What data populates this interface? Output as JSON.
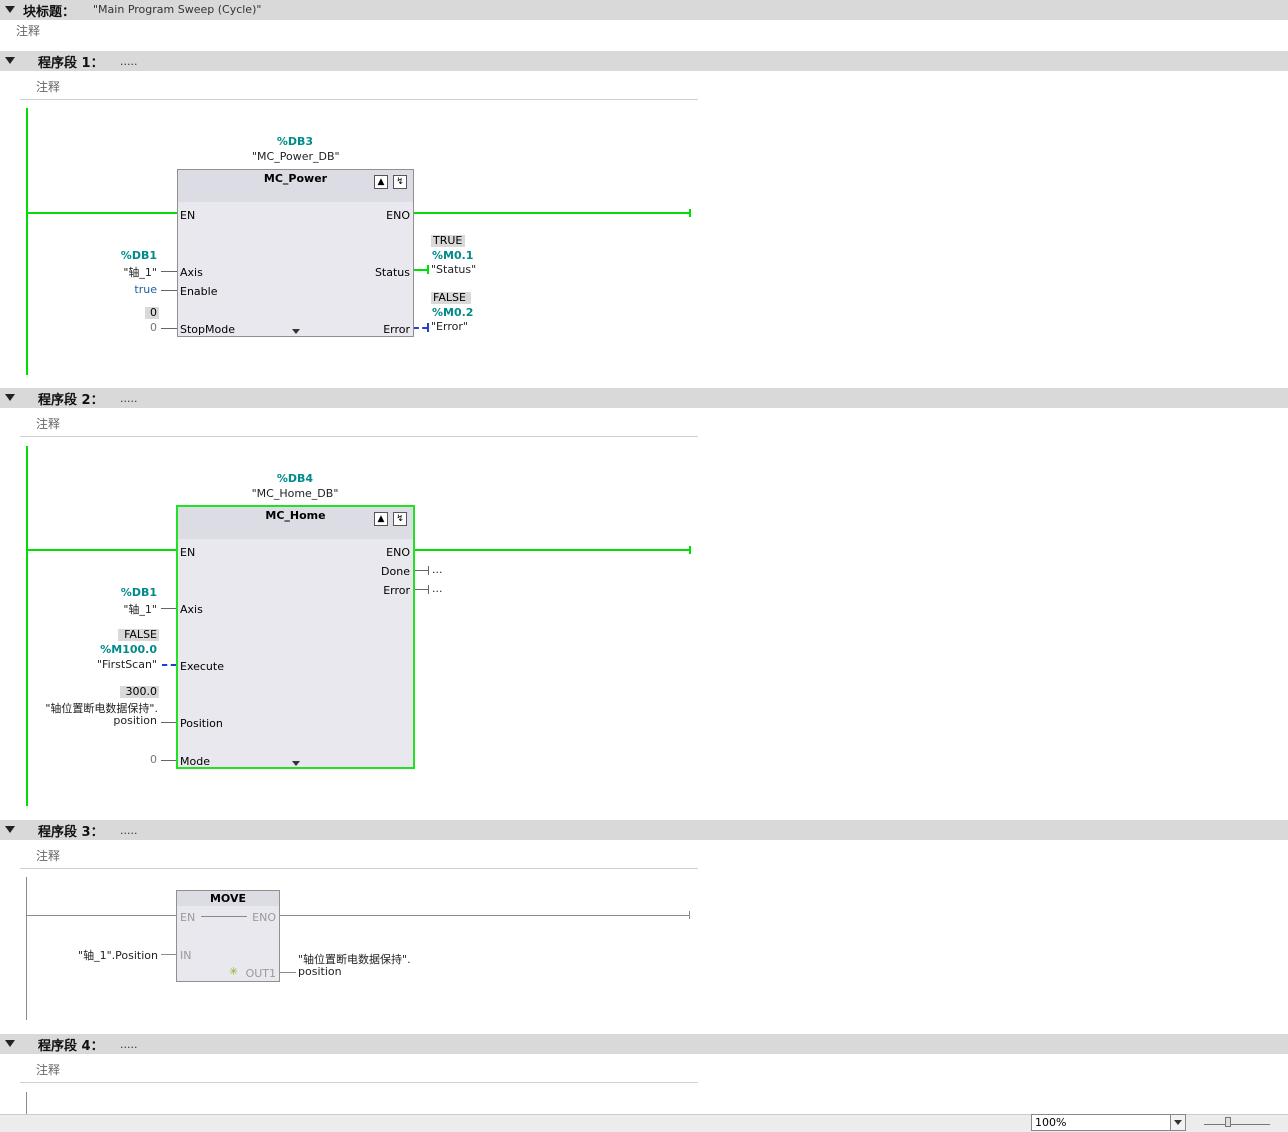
{
  "block": {
    "title_label": "块标题：",
    "title_value": "\"Main Program Sweep (Cycle)\"",
    "comment": "注释"
  },
  "networks": [
    {
      "label": "程序段 1：",
      "value": ".....",
      "comment": "注释"
    },
    {
      "label": "程序段 2：",
      "value": ".....",
      "comment": "注释"
    },
    {
      "label": "程序段 3：",
      "value": ".....",
      "comment": "注释"
    },
    {
      "label": "程序段 4：",
      "value": ".....",
      "comment": "注释"
    }
  ],
  "n1": {
    "db_addr": "%DB3",
    "db_name": "\"MC_Power_DB\"",
    "fb_name": "MC_Power",
    "pins_in": {
      "en": "EN",
      "axis": "Axis",
      "enable": "Enable",
      "stopmode": "StopMode"
    },
    "pins_out": {
      "eno": "ENO",
      "status": "Status",
      "error": "Error"
    },
    "axis_addr": "%DB1",
    "axis_name": "\"轴_1\"",
    "enable_val": "true",
    "stopmode_box": "0",
    "stopmode_val": "0",
    "status_box": "TRUE",
    "status_addr": "%M0.1",
    "status_name": "\"Status\"",
    "error_box": "FALSE",
    "error_addr": "%M0.2",
    "error_name": "\"Error\""
  },
  "n2": {
    "db_addr": "%DB4",
    "db_name": "\"MC_Home_DB\"",
    "fb_name": "MC_Home",
    "pins_in": {
      "en": "EN",
      "axis": "Axis",
      "execute": "Execute",
      "position": "Position",
      "mode": "Mode"
    },
    "pins_out": {
      "eno": "ENO",
      "done": "Done",
      "error": "Error"
    },
    "done_val": "...",
    "error_val": "...",
    "axis_addr": "%DB1",
    "axis_name": "\"轴_1\"",
    "execute_box": "FALSE",
    "execute_addr": "%M100.0",
    "execute_name": "\"FirstScan\"",
    "position_box": "300.0",
    "position_name1": "\"轴位置断电数据保持\".",
    "position_name2": "position",
    "mode_val": "0"
  },
  "n3": {
    "fb_name": "MOVE",
    "pin_en": "EN",
    "pin_eno": "ENO",
    "pin_in": "IN",
    "pin_out": "OUT1",
    "in_val": "\"轴_1\".Position",
    "out_val1": "\"轴位置断电数据保持\".",
    "out_val2": "position"
  },
  "statusbar": {
    "zoom": "100%"
  },
  "colors": {
    "power_flow": "#00e000",
    "address": "#008b8b",
    "header_bg": "#d9d9d9"
  }
}
